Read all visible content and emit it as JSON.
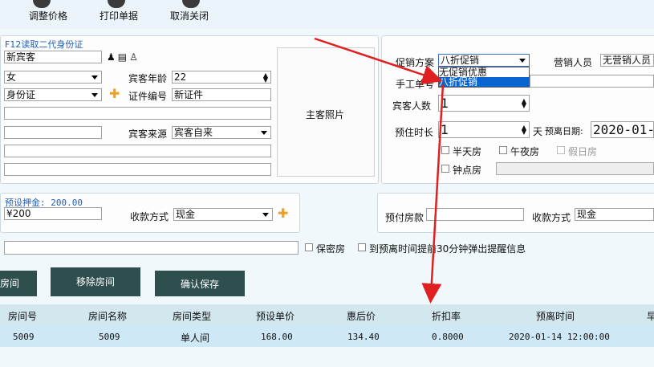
{
  "toolbar": {
    "adjust_price": "调整价格",
    "print_receipt": "打印单据",
    "cancel_close": "取消关闭"
  },
  "guest": {
    "read_id_label": "F12读取二代身份证",
    "name_value": "新宾客",
    "gender_value": "女",
    "age_label": "宾客年龄",
    "age_value": "22",
    "id_type_value": "身份证",
    "id_number_label": "证件编号",
    "id_number_value": "新证件",
    "source_label": "宾客来源",
    "source_value": "宾客自来",
    "photo_label": "主客照片"
  },
  "promo": {
    "plan_label": "促销方案",
    "plan_value": "八折促销",
    "dropdown_options": [
      "无促销优惠",
      "八折促销"
    ],
    "dropdown_selected_index": 1,
    "sales_label": "营销人员",
    "sales_value": "无营销人员",
    "manual_no_label": "手工单号",
    "guest_count_label": "宾客人数",
    "guest_count_value": "1",
    "stay_length_label": "预住时长",
    "stay_length_value": "1",
    "day_unit": "天",
    "departure_label": "预离日期:",
    "departure_value": "2020-01-",
    "half_day": "半天房",
    "midnight": "午夜房",
    "holiday": "假日房",
    "hourly": "钟点房"
  },
  "deposit": {
    "preset_label": "预设押金: 200.00",
    "amount_value": "¥200",
    "pay_method_label": "收款方式",
    "pay_method_value": "现金",
    "prepaid_label": "预付房款",
    "pay_method2_label": "收款方式",
    "pay_method2_value": "现金"
  },
  "options": {
    "confidential": "保密房",
    "reminder": "到预离时间提前30分钟弹出提醒信息"
  },
  "actions": {
    "room_partial": "房间",
    "remove_room": "移除房间",
    "confirm_save": "确认保存"
  },
  "table": {
    "headers": [
      "房间号",
      "房间名称",
      "房间类型",
      "预设单价",
      "惠后价",
      "折扣率",
      "预离时间",
      "早"
    ],
    "rows": [
      [
        "5009",
        "5009",
        "单人间",
        "168.00",
        "134.40",
        "0.8000",
        "2020-01-14 12:00:00"
      ]
    ]
  },
  "colors": {
    "accent_blue": "#1f5fbf",
    "header_dark": "#2f4f4f",
    "selection": "#0a64d0",
    "arrow": "#e02020"
  }
}
